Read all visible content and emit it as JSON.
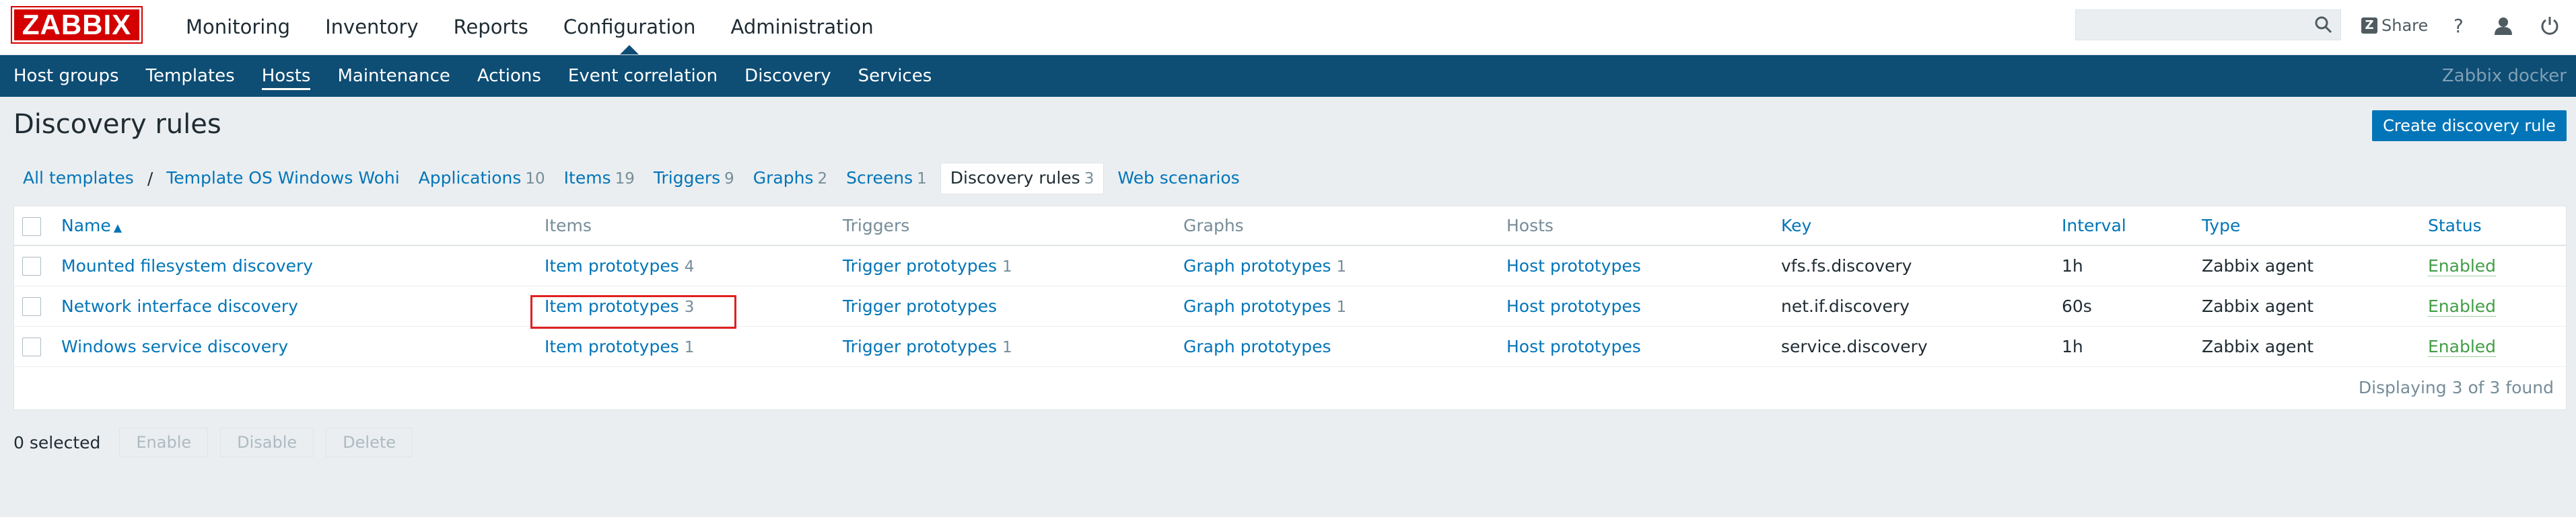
{
  "app": {
    "logo": "ZABBIX",
    "server_name": "Zabbix docker"
  },
  "main_nav": [
    {
      "label": "Monitoring"
    },
    {
      "label": "Inventory"
    },
    {
      "label": "Reports"
    },
    {
      "label": "Configuration",
      "active": true
    },
    {
      "label": "Administration"
    }
  ],
  "top_right": {
    "search_value": "",
    "share_label": "Share",
    "help_label": "?"
  },
  "sub_nav": [
    {
      "label": "Host groups"
    },
    {
      "label": "Templates"
    },
    {
      "label": "Hosts",
      "active": true
    },
    {
      "label": "Maintenance"
    },
    {
      "label": "Actions"
    },
    {
      "label": "Event correlation"
    },
    {
      "label": "Discovery"
    },
    {
      "label": "Services"
    }
  ],
  "header": {
    "title": "Discovery rules",
    "create_button": "Create discovery rule"
  },
  "breadcrumb": {
    "all_templates": "All templates",
    "separator": "/",
    "template": "Template OS Windows Wohi",
    "tabs": [
      {
        "label": "Applications",
        "count": "10"
      },
      {
        "label": "Items",
        "count": "19"
      },
      {
        "label": "Triggers",
        "count": "9"
      },
      {
        "label": "Graphs",
        "count": "2"
      },
      {
        "label": "Screens",
        "count": "1"
      },
      {
        "label": "Discovery rules",
        "count": "3",
        "current": true
      },
      {
        "label": "Web scenarios",
        "count": ""
      }
    ]
  },
  "table": {
    "columns": {
      "name": "Name",
      "items": "Items",
      "triggers": "Triggers",
      "graphs": "Graphs",
      "hosts": "Hosts",
      "key": "Key",
      "interval": "Interval",
      "type": "Type",
      "status": "Status"
    },
    "rows": [
      {
        "name": "Mounted filesystem discovery",
        "items": "Item prototypes",
        "items_count": "4",
        "triggers": "Trigger prototypes",
        "triggers_count": "1",
        "graphs": "Graph prototypes",
        "graphs_count": "1",
        "hosts": "Host prototypes",
        "key": "vfs.fs.discovery",
        "interval": "1h",
        "type": "Zabbix agent",
        "status": "Enabled"
      },
      {
        "name": "Network interface discovery",
        "items": "Item prototypes",
        "items_count": "3",
        "triggers": "Trigger prototypes",
        "triggers_count": "",
        "graphs": "Graph prototypes",
        "graphs_count": "1",
        "hosts": "Host prototypes",
        "key": "net.if.discovery",
        "interval": "60s",
        "type": "Zabbix agent",
        "status": "Enabled"
      },
      {
        "name": "Windows service discovery",
        "items": "Item prototypes",
        "items_count": "1",
        "triggers": "Trigger prototypes",
        "triggers_count": "1",
        "graphs": "Graph prototypes",
        "graphs_count": "",
        "hosts": "Host prototypes",
        "key": "service.discovery",
        "interval": "1h",
        "type": "Zabbix agent",
        "status": "Enabled"
      }
    ],
    "footer": "Displaying 3 of 3 found"
  },
  "bulk_actions": {
    "selected": "0 selected",
    "enable": "Enable",
    "disable": "Disable",
    "delete": "Delete"
  }
}
